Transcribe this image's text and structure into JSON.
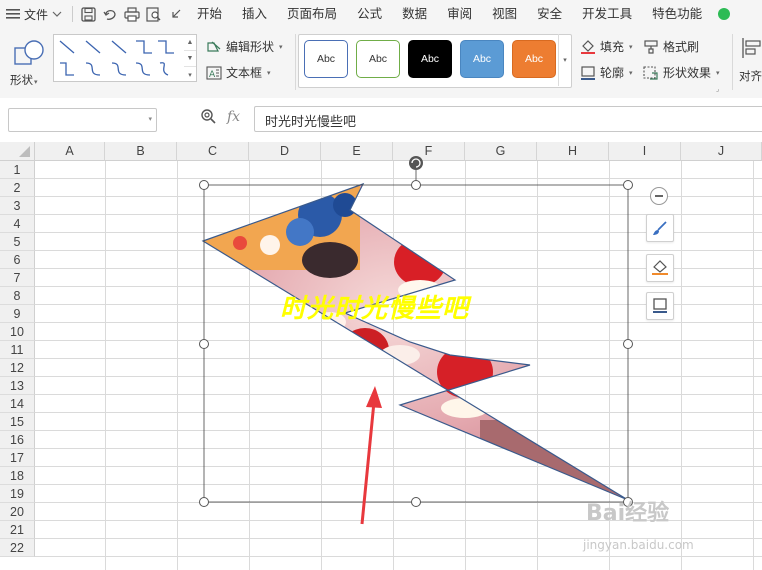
{
  "menubar": {
    "file_label": "文件",
    "items": [
      "开始",
      "插入",
      "页面布局",
      "公式",
      "数据",
      "审阅",
      "视图",
      "安全",
      "开发工具",
      "特色功能"
    ]
  },
  "ribbon": {
    "shape_label": "形状",
    "edit_shape_label": "编辑形状",
    "textbox_label": "文本框",
    "style_sample": "Abc",
    "styles": [
      {
        "bg": "#ffffff",
        "border": "#4a6fb5",
        "text": "#333333"
      },
      {
        "bg": "#ffffff",
        "border": "#70ad47",
        "text": "#333333"
      },
      {
        "bg": "#000000",
        "border": "#000000",
        "text": "#ffffff"
      },
      {
        "bg": "#5b9bd5",
        "border": "#4a86c0",
        "text": "#ffffff"
      },
      {
        "bg": "#ed7d31",
        "border": "#d86a20",
        "text": "#ffffff"
      }
    ],
    "fill_label": "填充",
    "outline_label": "轮廓",
    "format_painter_label": "格式刷",
    "shape_effects_label": "形状效果",
    "align_label": "对齐"
  },
  "formula_bar": {
    "name_box_value": "",
    "fx_label": "fx",
    "formula_value": "时光时光慢些吧"
  },
  "sheet": {
    "columns": [
      "A",
      "B",
      "C",
      "D",
      "E",
      "F",
      "G",
      "H",
      "I",
      "J"
    ],
    "rows": [
      "1",
      "2",
      "3",
      "4",
      "5",
      "6",
      "7",
      "8",
      "9",
      "10",
      "11",
      "12",
      "13",
      "14",
      "15",
      "16",
      "17",
      "18",
      "19",
      "20",
      "21",
      "22"
    ]
  },
  "shape": {
    "text": "时光时光慢些吧",
    "text_color": "#ffff00",
    "outline_color": "#3a5a8c"
  },
  "annotation_arrow_color": "#e8383d",
  "watermark": {
    "brand": "Bai经验",
    "url": "jingyan.baidu.com"
  }
}
